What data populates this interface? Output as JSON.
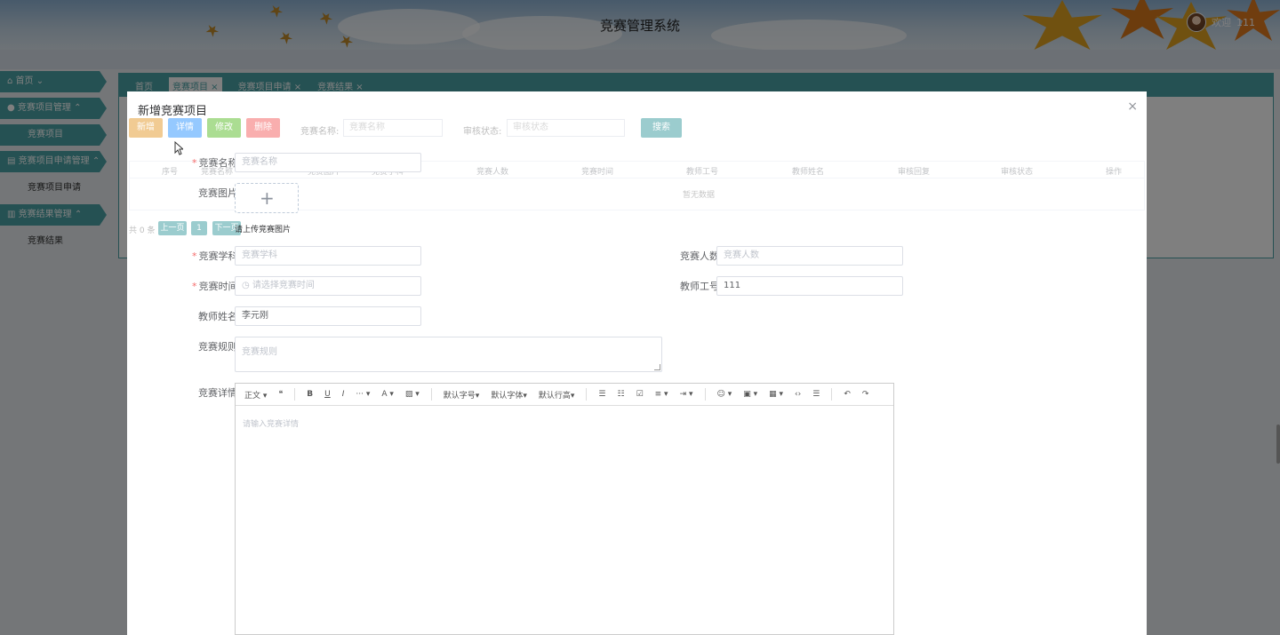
{
  "header": {
    "title": "竞赛管理系统",
    "welcome": "欢迎",
    "username": "111"
  },
  "sidebar": {
    "items": [
      {
        "label": "首页",
        "icon": "home-icon"
      },
      {
        "label": "竞赛项目管理",
        "icon": "circle-icon",
        "children": [
          "竞赛项目"
        ]
      },
      {
        "label": "竞赛项目申请管理",
        "icon": "doc-icon",
        "children": [
          "竞赛项目申请"
        ]
      },
      {
        "label": "竞赛结果管理",
        "icon": "folder-icon",
        "children": [
          "竞赛结果"
        ]
      }
    ]
  },
  "tabs": [
    "首页",
    "竞赛项目",
    "竞赛项目申请",
    "竞赛结果"
  ],
  "list": {
    "buttons": [
      "新增",
      "详情",
      "修改",
      "删除"
    ],
    "button_colors": [
      "#e6a23c",
      "#409eff",
      "#67c23a",
      "#f56c6c"
    ],
    "search_name_label": "竞赛名称:",
    "search_name_placeholder": "竞赛名称",
    "search_status_label": "审核状态:",
    "search_status_placeholder": "审核状态",
    "search_button": "搜索",
    "columns": [
      "序号",
      "竞赛名称",
      "竞赛图片",
      "竞赛学科",
      "竞赛人数",
      "竞赛时间",
      "教师工号",
      "教师姓名",
      "审核回复",
      "审核状态",
      "操作"
    ],
    "empty_text": "暂无数据",
    "pager_total": "共 0 条",
    "pager_prev": "上一页",
    "pager_page": "1",
    "pager_next": "下一页"
  },
  "dialog": {
    "title": "新增竞赛项目",
    "close": "×",
    "fields": {
      "name_label": "竞赛名称",
      "name_placeholder": "竞赛名称",
      "image_label": "竞赛图片",
      "upload_tip": "请上传竞赛图片",
      "subject_label": "竞赛学科",
      "subject_placeholder": "竞赛学科",
      "count_label": "竞赛人数",
      "count_placeholder": "竞赛人数",
      "time_label": "竞赛时间",
      "time_placeholder": "请选择竞赛时间",
      "teacher_id_label": "教师工号",
      "teacher_id_value": "111",
      "teacher_name_label": "教师姓名",
      "teacher_name_value": "李元刚",
      "rules_label": "竞赛规则",
      "rules_placeholder": "竞赛规则",
      "details_label": "竞赛详情",
      "details_placeholder": "请输入竞赛详情"
    },
    "editor_toolbar": {
      "paragraph": "正文",
      "font_size": "默认字号",
      "font_family": "默认字体",
      "line_height": "默认行高"
    }
  },
  "colors": {
    "theme": "#4aa3a7",
    "required": "#f56c6c"
  }
}
